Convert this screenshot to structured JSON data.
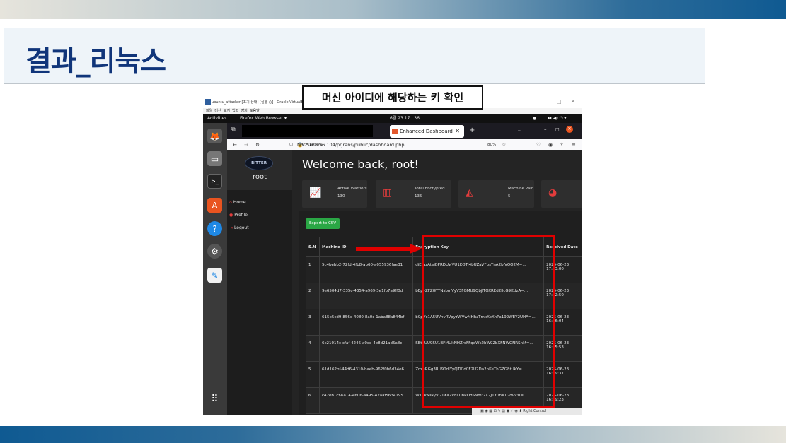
{
  "slide": {
    "title": "결과_리눅스"
  },
  "callout": {
    "text": "머신 아이디에 해당하는 키 확인"
  },
  "colors": {
    "accent": "#10357a",
    "highlight": "#e00000",
    "export": "#2aa745",
    "danger_icon": "#e23c3c"
  },
  "vbox": {
    "title": "ubuntu_attacker [초기 상태] [실행 중] - Oracle VirtualBox",
    "menu": [
      "파일",
      "머신",
      "보기",
      "입력",
      "장치",
      "도움말"
    ]
  },
  "gnome": {
    "activities": "Activities",
    "app": "Firefox Web Browser ▾",
    "clock": "6월 23  17 : 36"
  },
  "browser": {
    "tab_title": "Enhanced Dashboard",
    "security_label": "Not Secure",
    "url": "192.168.56.104/prjrans/public/dashboard.php",
    "zoom": "80%"
  },
  "sidebar": {
    "logo": "BITTER",
    "user": "root",
    "links": [
      "Home",
      "Profile",
      "Logout"
    ]
  },
  "main": {
    "welcome": "Welcome back, root!",
    "cards": [
      {
        "label": "Active Warriors",
        "value": "130",
        "icon": "line-chart-icon"
      },
      {
        "label": "Total Encrypted",
        "value": "135",
        "icon": "bar-chart-icon"
      },
      {
        "label": "Machine Paid",
        "value": "5",
        "icon": "area-chart-icon"
      },
      {
        "label": "",
        "value": "",
        "icon": "pie-chart-icon"
      }
    ],
    "export_label": "Export to CSV",
    "table": {
      "headers": [
        "S.N",
        "Machine ID",
        "Encryption Key",
        "Received Date"
      ],
      "rows": [
        {
          "sn": "1",
          "machine_id": "5c4bebb2-72fd-4fb8-ab60-a055936fae31",
          "key": "djEtazAtejBPRDUwVU1EOTI4bUZaVFpsTnA2bjVQQ2M=...",
          "date": "2025-06-23",
          "time": "17:03:00"
        },
        {
          "sn": "2",
          "machine_id": "9e6504d7-335c-4354-a969-3e1fb7a9ff0d",
          "key": "bEpvZFZGTTNsbmVyV3FGMU9QbjlTOXREd2llcG9KUzA=...",
          "date": "2025-06-23",
          "time": "17:02:50"
        },
        {
          "sn": "3",
          "machine_id": "615e5cd9-856c-4080-8a0c-1aba88a844bf",
          "key": "b0pVc1A5UVhvRVpyYWVwMHhzTmxXeXhPa192WEY2UHA=...",
          "date": "2025-06-23",
          "time": "16:46:04"
        },
        {
          "sn": "4",
          "machine_id": "6c21014c-cfaf-4246-a0ce-4e8d21ad5a8c",
          "key": "SEtuUU9SU1BFMUltNHZrcFFqeWs2bW92bXFNWGNRSnM=...",
          "date": "2025-06-23",
          "time": "16:45:53"
        },
        {
          "sn": "5",
          "machine_id": "61d162bf-44d6-4310-baeb-962f0b6d34e6",
          "key": "ZmlsRGg3RU90dlYyQTlCd0F2U2Da2hKeThGZG8tUkY=...",
          "date": "2025-06-23",
          "time": "16:39:37"
        },
        {
          "sn": "6",
          "machine_id": "c42eb1cf-6a14-4606-a495-42aaf5634195",
          "key": "WTZkMlRyVG1Xa2VELTlnRDdSNmt2X2J1Y0hXTGdvVzI=...",
          "date": "2025-06-23",
          "time": "16:39:23"
        }
      ]
    }
  },
  "taskbar": {
    "label": "Right Control"
  }
}
